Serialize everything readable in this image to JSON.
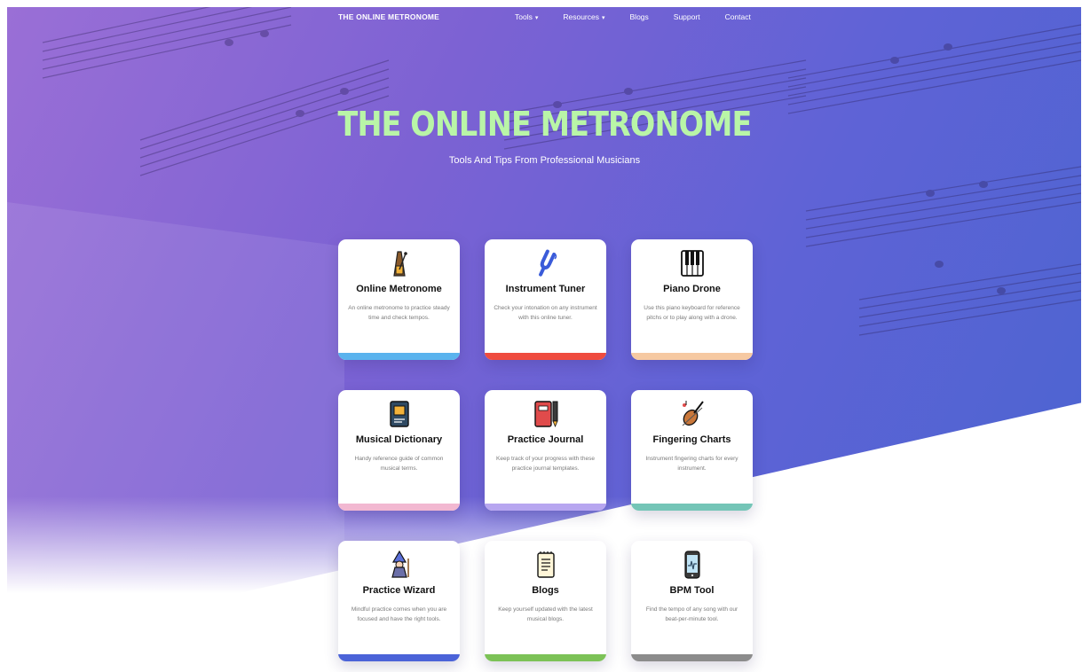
{
  "nav": {
    "brand": "THE ONLINE METRONOME",
    "links": [
      {
        "label": "Tools",
        "caret": "▾"
      },
      {
        "label": "Resources",
        "caret": "▾"
      },
      {
        "label": "Blogs",
        "caret": ""
      },
      {
        "label": "Support",
        "caret": ""
      },
      {
        "label": "Contact",
        "caret": ""
      }
    ]
  },
  "hero": {
    "title": "THE ONLINE METRONOME",
    "subtitle": "Tools And Tips From Professional Musicians",
    "gradient_start": "#9a6fd6",
    "gradient_end": "#4a64d0",
    "title_color": "#b9f5a7"
  },
  "cards": [
    {
      "title": "Online Metronome",
      "desc": "An online metronome to practice steady time and check tempos.",
      "icon": "metronome-icon",
      "accent": "#5ab3ee"
    },
    {
      "title": "Instrument Tuner",
      "desc": "Check your intonation on any instrument with this online tuner.",
      "icon": "tuning-fork-icon",
      "accent": "#ef4b3f"
    },
    {
      "title": "Piano Drone",
      "desc": "Use this piano keyboard for reference pitchs or to play along with a drone.",
      "icon": "piano-keys-icon",
      "accent": "#f6c9a2"
    },
    {
      "title": "Musical Dictionary",
      "desc": "Handy reference guide of common musical terms.",
      "icon": "dictionary-book-icon",
      "accent": "#f2b8d1"
    },
    {
      "title": "Practice Journal",
      "desc": "Keep track of your progress with these practice journal templates.",
      "icon": "journal-pen-icon",
      "accent": "#b7a6f0"
    },
    {
      "title": "Fingering Charts",
      "desc": "Instrument fingering charts for every instrument.",
      "icon": "violin-icon",
      "accent": "#74c5b7"
    },
    {
      "title": "Practice Wizard",
      "desc": "Mindful practice comes when you are focused and have the right tools.",
      "icon": "wizard-icon",
      "accent": "#4b63d8"
    },
    {
      "title": "Blogs",
      "desc": "Keep yourself updated with the latest musical blogs.",
      "icon": "notepad-icon",
      "accent": "#7cc257"
    },
    {
      "title": "BPM Tool",
      "desc": "Find the tempo of any song with our beat-per-minute tool.",
      "icon": "phone-bpm-icon",
      "accent": "#8c8c8c"
    }
  ]
}
